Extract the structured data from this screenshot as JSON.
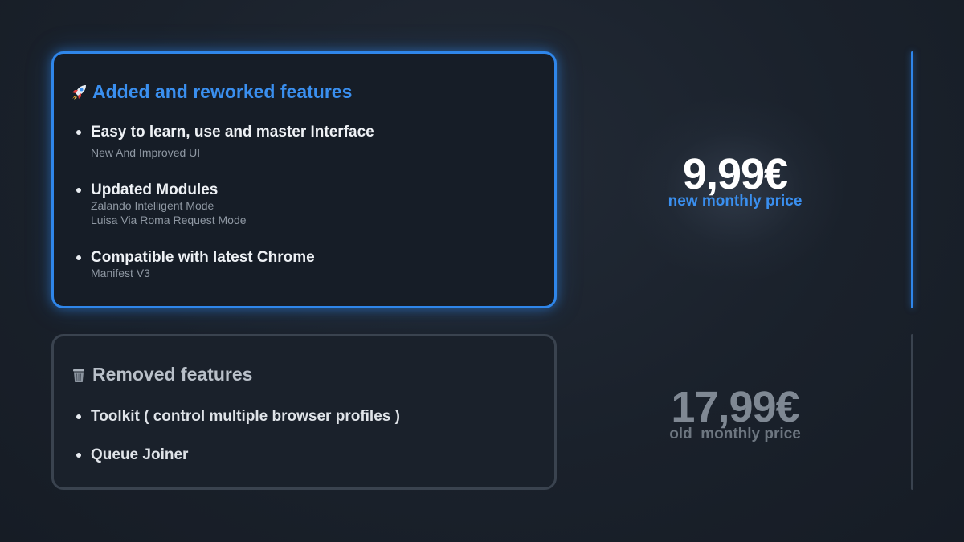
{
  "added_card": {
    "icon": "rocket-icon",
    "title": "Added and reworked features",
    "features": [
      {
        "title": "Easy to learn, use and master Interface",
        "details": [
          "New And Improved UI"
        ]
      },
      {
        "title": "Updated Modules",
        "details": [
          "Zalando Intelligent Mode",
          "Luisa Via Roma Request Mode"
        ]
      },
      {
        "title": "Compatible with latest Chrome",
        "details": [
          "Manifest V3"
        ]
      }
    ]
  },
  "removed_card": {
    "icon": "trash-icon",
    "title": "Removed features",
    "features": [
      {
        "title": "Toolkit ( control multiple browser profiles )"
      },
      {
        "title": "Queue Joiner"
      }
    ]
  },
  "new_price": {
    "value": "9,99€",
    "label": "new monthly price"
  },
  "old_price": {
    "value": "17,99€",
    "label": "old  monthly price"
  },
  "colors": {
    "accent": "#2f86ea",
    "background": "#1a212b",
    "muted": "#3a434f"
  }
}
